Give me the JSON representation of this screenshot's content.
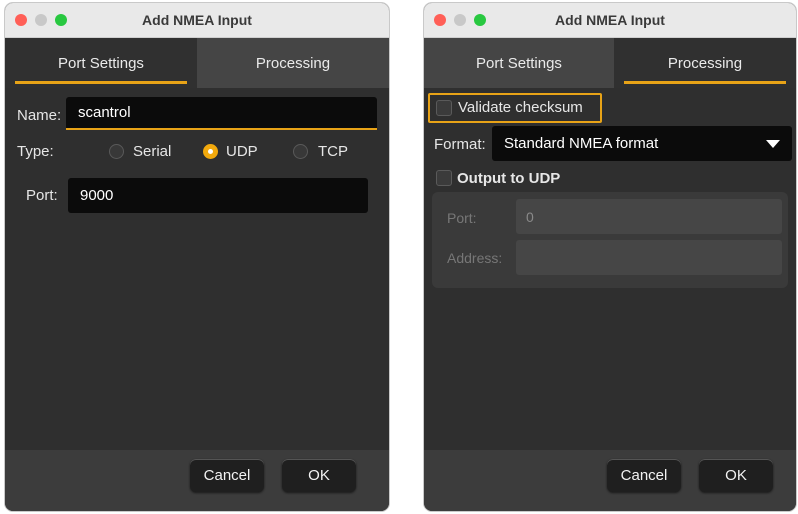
{
  "left_dialog": {
    "title": "Add NMEA Input",
    "tabs": [
      {
        "label": "Port Settings",
        "active": true
      },
      {
        "label": "Processing",
        "active": false
      }
    ],
    "name_label": "Name:",
    "name_value": "scantrol",
    "type_label": "Type:",
    "type_options": [
      {
        "label": "Serial",
        "selected": false
      },
      {
        "label": "UDP",
        "selected": true
      },
      {
        "label": "TCP",
        "selected": false
      }
    ],
    "port_label": "Port:",
    "port_value": "9000",
    "cancel_label": "Cancel",
    "ok_label": "OK"
  },
  "right_dialog": {
    "title": "Add NMEA Input",
    "tabs": [
      {
        "label": "Port Settings",
        "active": false
      },
      {
        "label": "Processing",
        "active": true
      }
    ],
    "validate_checksum_label": "Validate checksum",
    "validate_checksum_checked": false,
    "format_label": "Format:",
    "format_value": "Standard NMEA format",
    "output_udp_label": "Output to UDP",
    "output_udp_checked": false,
    "port_label": "Port:",
    "port_value": "0",
    "address_label": "Address:",
    "address_value": "",
    "cancel_label": "Cancel",
    "ok_label": "OK"
  },
  "colors": {
    "accent": "#e8a317",
    "window_bg": "#2f2f2f",
    "field_bg": "#0b0b0b",
    "close": "#ff5f57",
    "zoom": "#28c840"
  }
}
